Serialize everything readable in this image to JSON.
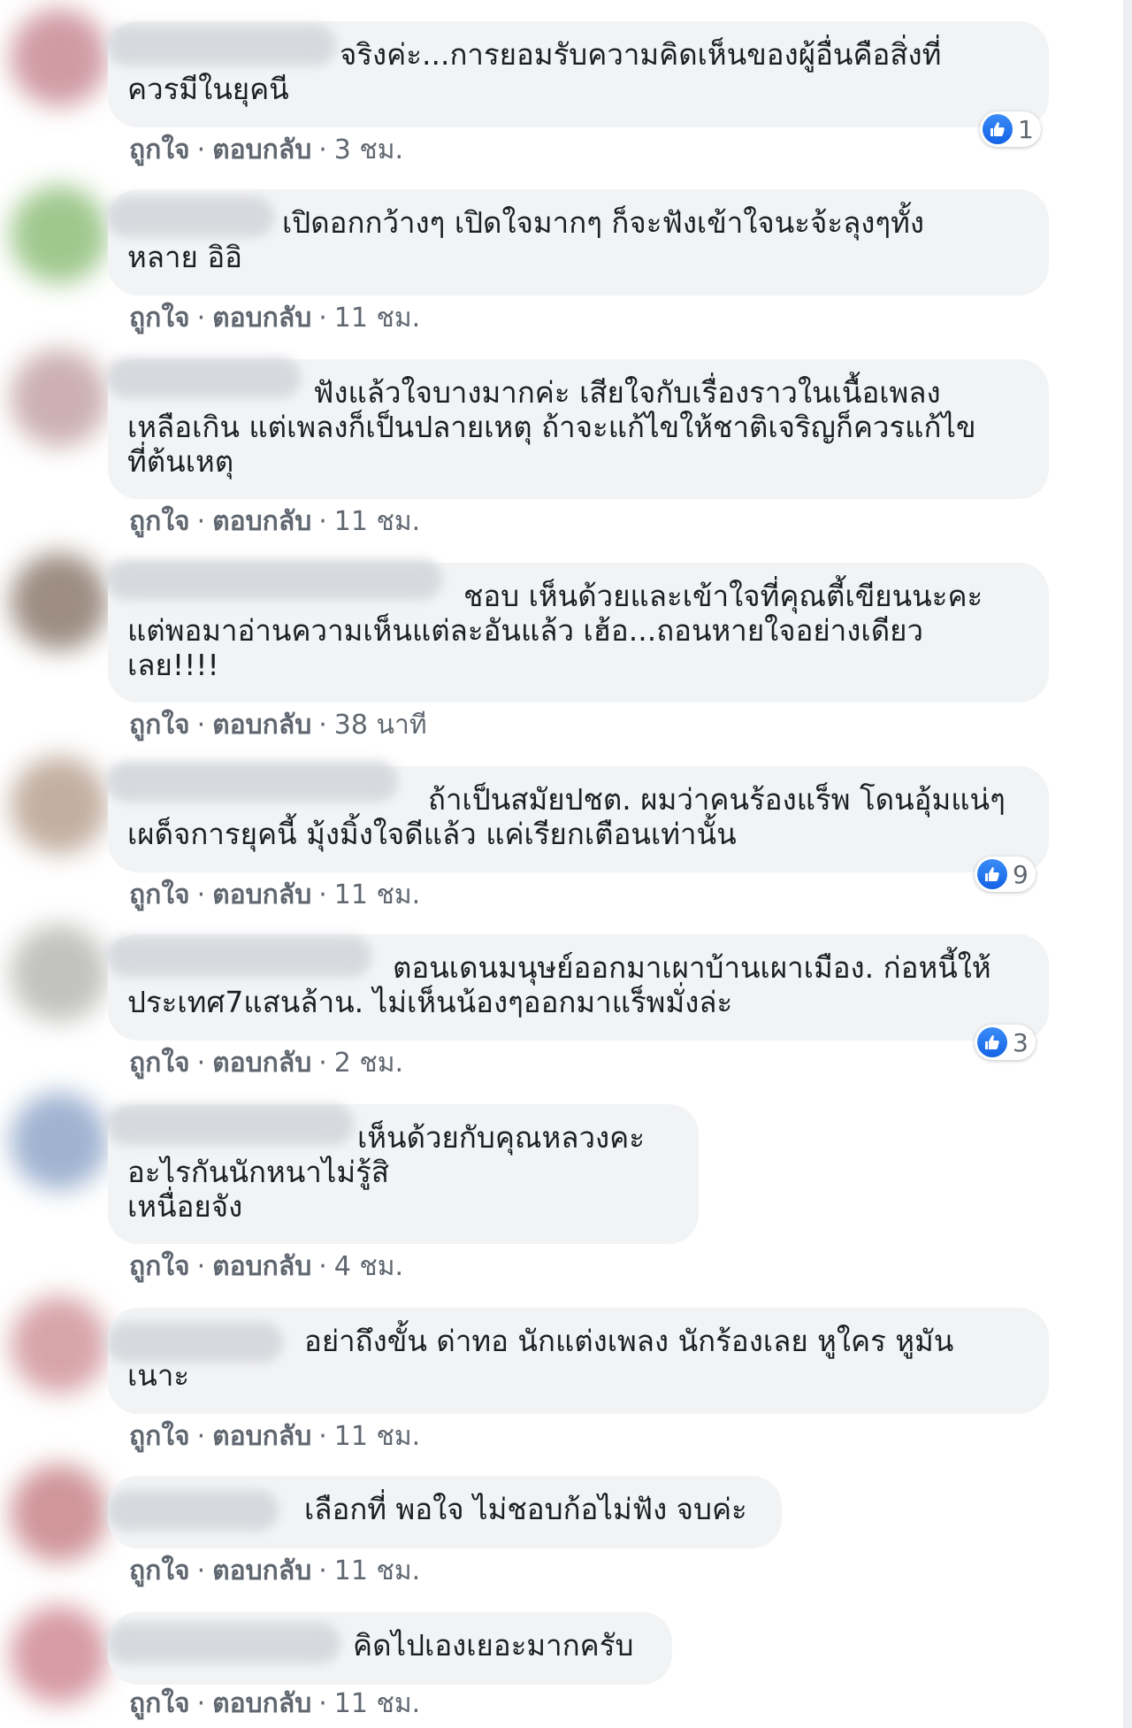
{
  "actions": {
    "like_label": "ถูกใจ",
    "reply_label": "ตอบกลับ",
    "separator": "·"
  },
  "colors": {
    "like_blue": "#1877f2",
    "bubble_bg": "#f2f3f5",
    "meta_gray": "#606770"
  },
  "icons": {
    "reaction": "like-thumbs-up-icon"
  },
  "comments": [
    {
      "text": "จริงค่ะ...การยอมรับความคิดเห็นของผู้อื่นคือสิ่งที่\nควรมีในยุคนี",
      "time": "3 ชม.",
      "reactions": "1"
    },
    {
      "text": "เปิดอกกว้างๆ เปิดใจมากๆ ก็จะฟังเข้าใจนะจ้ะลุงๆทั้ง\nหลาย อิอิ",
      "time": "11 ชม."
    },
    {
      "text": "ฟังแล้วใจบางมากค่ะ เสียใจกับเรื่องราวในเนื้อเพลง\nเหลือเกิน แต่เพลงก็เป็นปลายเหตุ ถ้าจะแก้ไขให้ชาติเจริญก็ควรแก้ไข\nที่ต้นเหตุ",
      "time": "11 ชม."
    },
    {
      "text": "ชอบ เห็นด้วยและเข้าใจที่คุณตี้เขียนนะคะ\nแต่พอมาอ่านความเห็นแต่ละอันแล้ว เฮ้อ...ถอนหายใจอย่างเดียว\nเลย!!!!",
      "time": "38 นาที"
    },
    {
      "text": "ถ้าเป็นสมัยปชต. ผมว่าคนร้องแร็พ โดนอุ้มแน่ๆ\nเผด็จการยุคนี้ มุ้งมิ้งใจดีแล้ว แค่เรียกเตือนเท่านั้น",
      "time": "11 ชม.",
      "reactions": "9"
    },
    {
      "text": "ตอนเดนมนุษย์ออกมาเผาบ้านเผาเมือง. ก่อหนี้ให้\nประเทศ7แสนล้าน. ไม่เห็นน้องๆออกมาแร็พมั่งล่ะ",
      "time": "2 ชม.",
      "reactions": "3"
    },
    {
      "text": "เห็นด้วยกับคุณหลวงคะ\nอะไรกันนักหนาไม่รู้สิ\nเหนื่อยจัง",
      "time": "4 ชม."
    },
    {
      "text": "อย่าถึงขั้น ด่าทอ นักแต่งเพลง นักร้องเลย หูใคร หูมัน\nเนาะ",
      "time": "11 ชม."
    },
    {
      "text": "เลือกที่ พอใจ ไม่ชอบก้อไม่ฟัง จบค่ะ",
      "time": "11 ชม."
    },
    {
      "text": "คิดไปเองเยอะมากครับ",
      "time": "11 ชม."
    }
  ]
}
